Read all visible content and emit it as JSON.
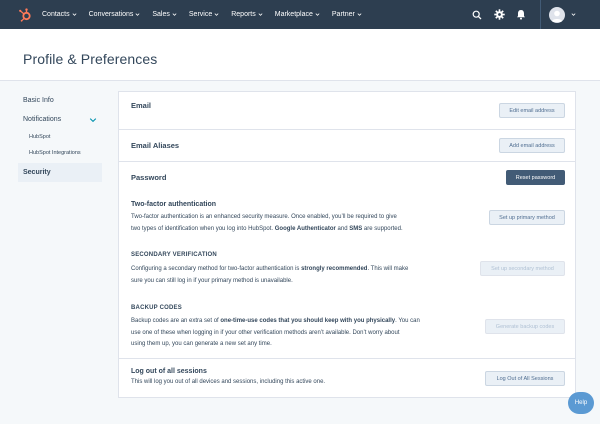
{
  "nav": {
    "logo_icon": "hubspot-sprocket-icon",
    "items": [
      {
        "label": "Contacts"
      },
      {
        "label": "Conversations"
      },
      {
        "label": "Sales"
      },
      {
        "label": "Service"
      },
      {
        "label": "Reports"
      },
      {
        "label": "Marketplace"
      },
      {
        "label": "Partner"
      }
    ],
    "right_icons": [
      "search-icon",
      "gear-icon",
      "bell-icon"
    ],
    "colors": {
      "bar": "#2d3e50",
      "logo": "#ff7a59"
    }
  },
  "header": {
    "title": "Profile & Preferences"
  },
  "sidebar": {
    "items": [
      {
        "label": "Basic Info"
      },
      {
        "label": "Notifications"
      },
      {
        "label": "HubSpot"
      },
      {
        "label": "HubSpot Integrations"
      },
      {
        "label": "Security"
      }
    ]
  },
  "main": {
    "email": {
      "title": "Email",
      "button": "Edit email address"
    },
    "aliases": {
      "title": "Email Aliases",
      "button": "Add email address"
    },
    "password": {
      "title": "Password",
      "button": "Reset password",
      "tfa": {
        "title": "Two-factor authentication",
        "text_1": "Two-factor authentication is an enhanced security measure. Once enabled, you’ll be required to give",
        "text_2a": "two types of identification when you log into HubSpot. ",
        "text_2b": "Google Authenticator",
        "text_2c": " and ",
        "text_2d": "SMS",
        "text_2e": " are supported.",
        "button": "Set up primary method"
      },
      "secondary": {
        "title": "SECONDARY VERIFICATION",
        "text_1a": "Configuring a secondary method for two-factor authentication is ",
        "text_1b": "strongly recommended",
        "text_1c": ". This will make",
        "text_2": "sure you can still log in if your primary method is unavailable.",
        "button": "Set up secondary method"
      },
      "backup": {
        "title": "BACKUP CODES",
        "text_1a": "Backup codes are an extra set of ",
        "text_1b": "one-time-use codes that you should keep with you physically",
        "text_1c": ". You can",
        "text_2": "use one of these when logging in if your other verification methods aren’t available. Don’t worry about",
        "text_3": "using them up, you can generate a new set any time.",
        "button": "Generate backup codes"
      }
    },
    "logout": {
      "title": "Log out of all sessions",
      "text": "This will log you out of all devices and sessions, including this active one.",
      "button": "Log Out of All Sessions"
    }
  },
  "help": {
    "label": "Help"
  }
}
